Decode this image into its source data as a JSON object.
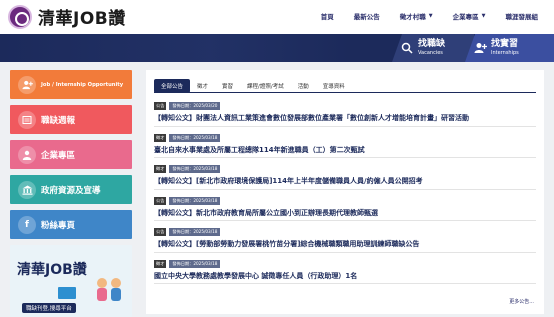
{
  "header": {
    "logo_text": "清華JOB讚",
    "nav": [
      {
        "label": "首頁"
      },
      {
        "label": "最新公告"
      },
      {
        "label": "徵才村職",
        "caret": "▼"
      },
      {
        "label": "企業專區",
        "caret": "▼"
      },
      {
        "label": "職涯發展組"
      }
    ]
  },
  "banner": {
    "vacancies_zh": "找職缺",
    "vacancies_en": "Vacancies",
    "internships_zh": "找實習",
    "internships_en": "Internships"
  },
  "sidebar": {
    "items": [
      {
        "label": "Job / Internship Opportunity",
        "color": "#f27b3a"
      },
      {
        "label": "職缺週報",
        "color": "#f0595e"
      },
      {
        "label": "企業專區",
        "color": "#e96a8d"
      },
      {
        "label": "政府資源及宣導",
        "color": "#2ea7a2"
      },
      {
        "label": "粉絲專頁",
        "color": "#3f86c8"
      }
    ],
    "promo_title": "清華JOB讚",
    "promo_sub": "職缺刊登,搜尋平台"
  },
  "main": {
    "tabs": [
      "全部公告",
      "徵才",
      "實習",
      "課程/證照/考試",
      "活動",
      "宣導資料"
    ],
    "news": [
      {
        "category": "公告",
        "date": "發佈日期：2025/03/20",
        "title": "【轉知公文】財團法人資訊工業策進會數位發展部數位產業署「數位創新人才增能培育計畫」研習活動"
      },
      {
        "category": "徵才",
        "date": "發佈日期：2025/03/18",
        "title": "臺北自來水事業處及所屬工程總隊114年新進職員（工）第二次甄試"
      },
      {
        "category": "徵才",
        "date": "發佈日期：2025/03/18",
        "title": "【轉知公文】[新北市政府環境保護局]114年上半年度儲備職員人員/約僱人員公開招考"
      },
      {
        "category": "公告",
        "date": "發佈日期：2025/03/18",
        "title": "【轉知公文】新北市政府教育局所屬公立國小到正辦理長期代理教師甄選"
      },
      {
        "category": "公告",
        "date": "發佈日期：2025/03/18",
        "title": "【轉知公文】[勞動部勞動力發展署桃竹苗分署]綜合機械職類職用助理訓練師職缺公告"
      },
      {
        "category": "徵才",
        "date": "發佈日期：2025/03/18",
        "title": "國立中央大學教務處教學發展中心 誠徵專任人員（行政助理）1名"
      }
    ],
    "more": "更多公告..."
  }
}
